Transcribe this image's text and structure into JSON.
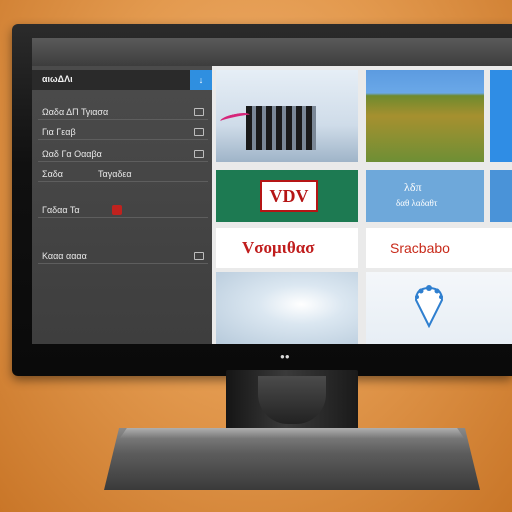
{
  "sidebar": {
    "header": "αιωΔΛι",
    "accent_symbol": "↓",
    "items": [
      {
        "label": "Ωαδα ΔΠ Τγιασα"
      },
      {
        "label": "Για Γεαβ",
        "has_menu": true
      },
      {
        "label": "Ωαδ Γα Οααβα"
      },
      {
        "label": "Σαδα",
        "label2": "Ταγαδεα"
      },
      {
        "label": "Γαδαα Τα"
      },
      {
        "label": "Κααα αααα"
      }
    ]
  },
  "tiles": {
    "tile4_logo": "VDV",
    "tile5_line1": "λδπ",
    "tile5_line2": "δαθ λαδαθτ",
    "tile7_text": "Vσομιθασ",
    "tile8_text": "Sracbabo"
  },
  "monitor": {
    "brand_mark": "●●"
  },
  "colors": {
    "accent_blue": "#2f8fe0",
    "brand_red": "#c01d1d",
    "wall_orange": "#e39a4f"
  }
}
